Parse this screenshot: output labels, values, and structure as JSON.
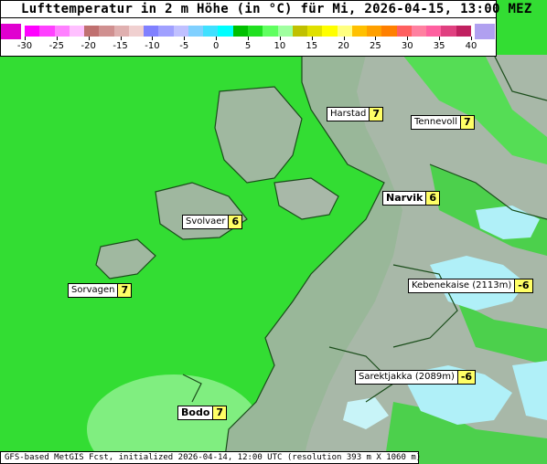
{
  "title": "Lufttemperatur in 2 m Höhe (in °C) für Mi, 2026-04-15, 13:00 MEZ",
  "scale": {
    "ticks": [
      "-30",
      "-25",
      "-20",
      "-15",
      "-10",
      "-5",
      "0",
      "5",
      "10",
      "15",
      "20",
      "25",
      "30",
      "35",
      "40"
    ],
    "low_end_color": "#e000d0",
    "high_end_color": "#b0a0f0",
    "colors": [
      "#ff00ff",
      "#ff40ff",
      "#ff80ff",
      "#ffc0ff",
      "#c07070",
      "#d09090",
      "#e0b0b0",
      "#f0d0d0",
      "#8080ff",
      "#a0a0ff",
      "#c0c0ff",
      "#80d0ff",
      "#40e0ff",
      "#00ffff",
      "#00c000",
      "#20e020",
      "#60ff60",
      "#a0ffa0",
      "#c0c000",
      "#e0e000",
      "#ffff00",
      "#ffff80",
      "#ffc000",
      "#ffa000",
      "#ff8000",
      "#ff6060",
      "#ff80a0",
      "#ff60a0",
      "#e04080",
      "#c02060"
    ]
  },
  "stations": [
    {
      "name": "Harstad",
      "value": "7",
      "bold": false
    },
    {
      "name": "Tennevoll",
      "value": "7",
      "bold": false
    },
    {
      "name": "Narvik",
      "value": "6",
      "bold": true
    },
    {
      "name": "Svolvaer",
      "value": "6",
      "bold": false
    },
    {
      "name": "Sorvagen",
      "value": "7",
      "bold": false
    },
    {
      "name": "Kebenekaise (2113m)",
      "value": "-6",
      "bold": false
    },
    {
      "name": "Sarektjakka (2089m)",
      "value": "-6",
      "bold": false
    },
    {
      "name": "Bodo",
      "value": "7",
      "bold": true
    }
  ],
  "footer": "GFS-based MetGIS Fcst, initialized 2026-04-14, 12:00 UTC  (resolution 393 m X 1060 m)",
  "colors": {
    "sea": "#33dd33",
    "land_low": "#55ee55",
    "land_high": "#a8b8a8",
    "snow": "#b0f0f8",
    "warm_patch": "#80ee80",
    "label_value": "#ffff66"
  }
}
